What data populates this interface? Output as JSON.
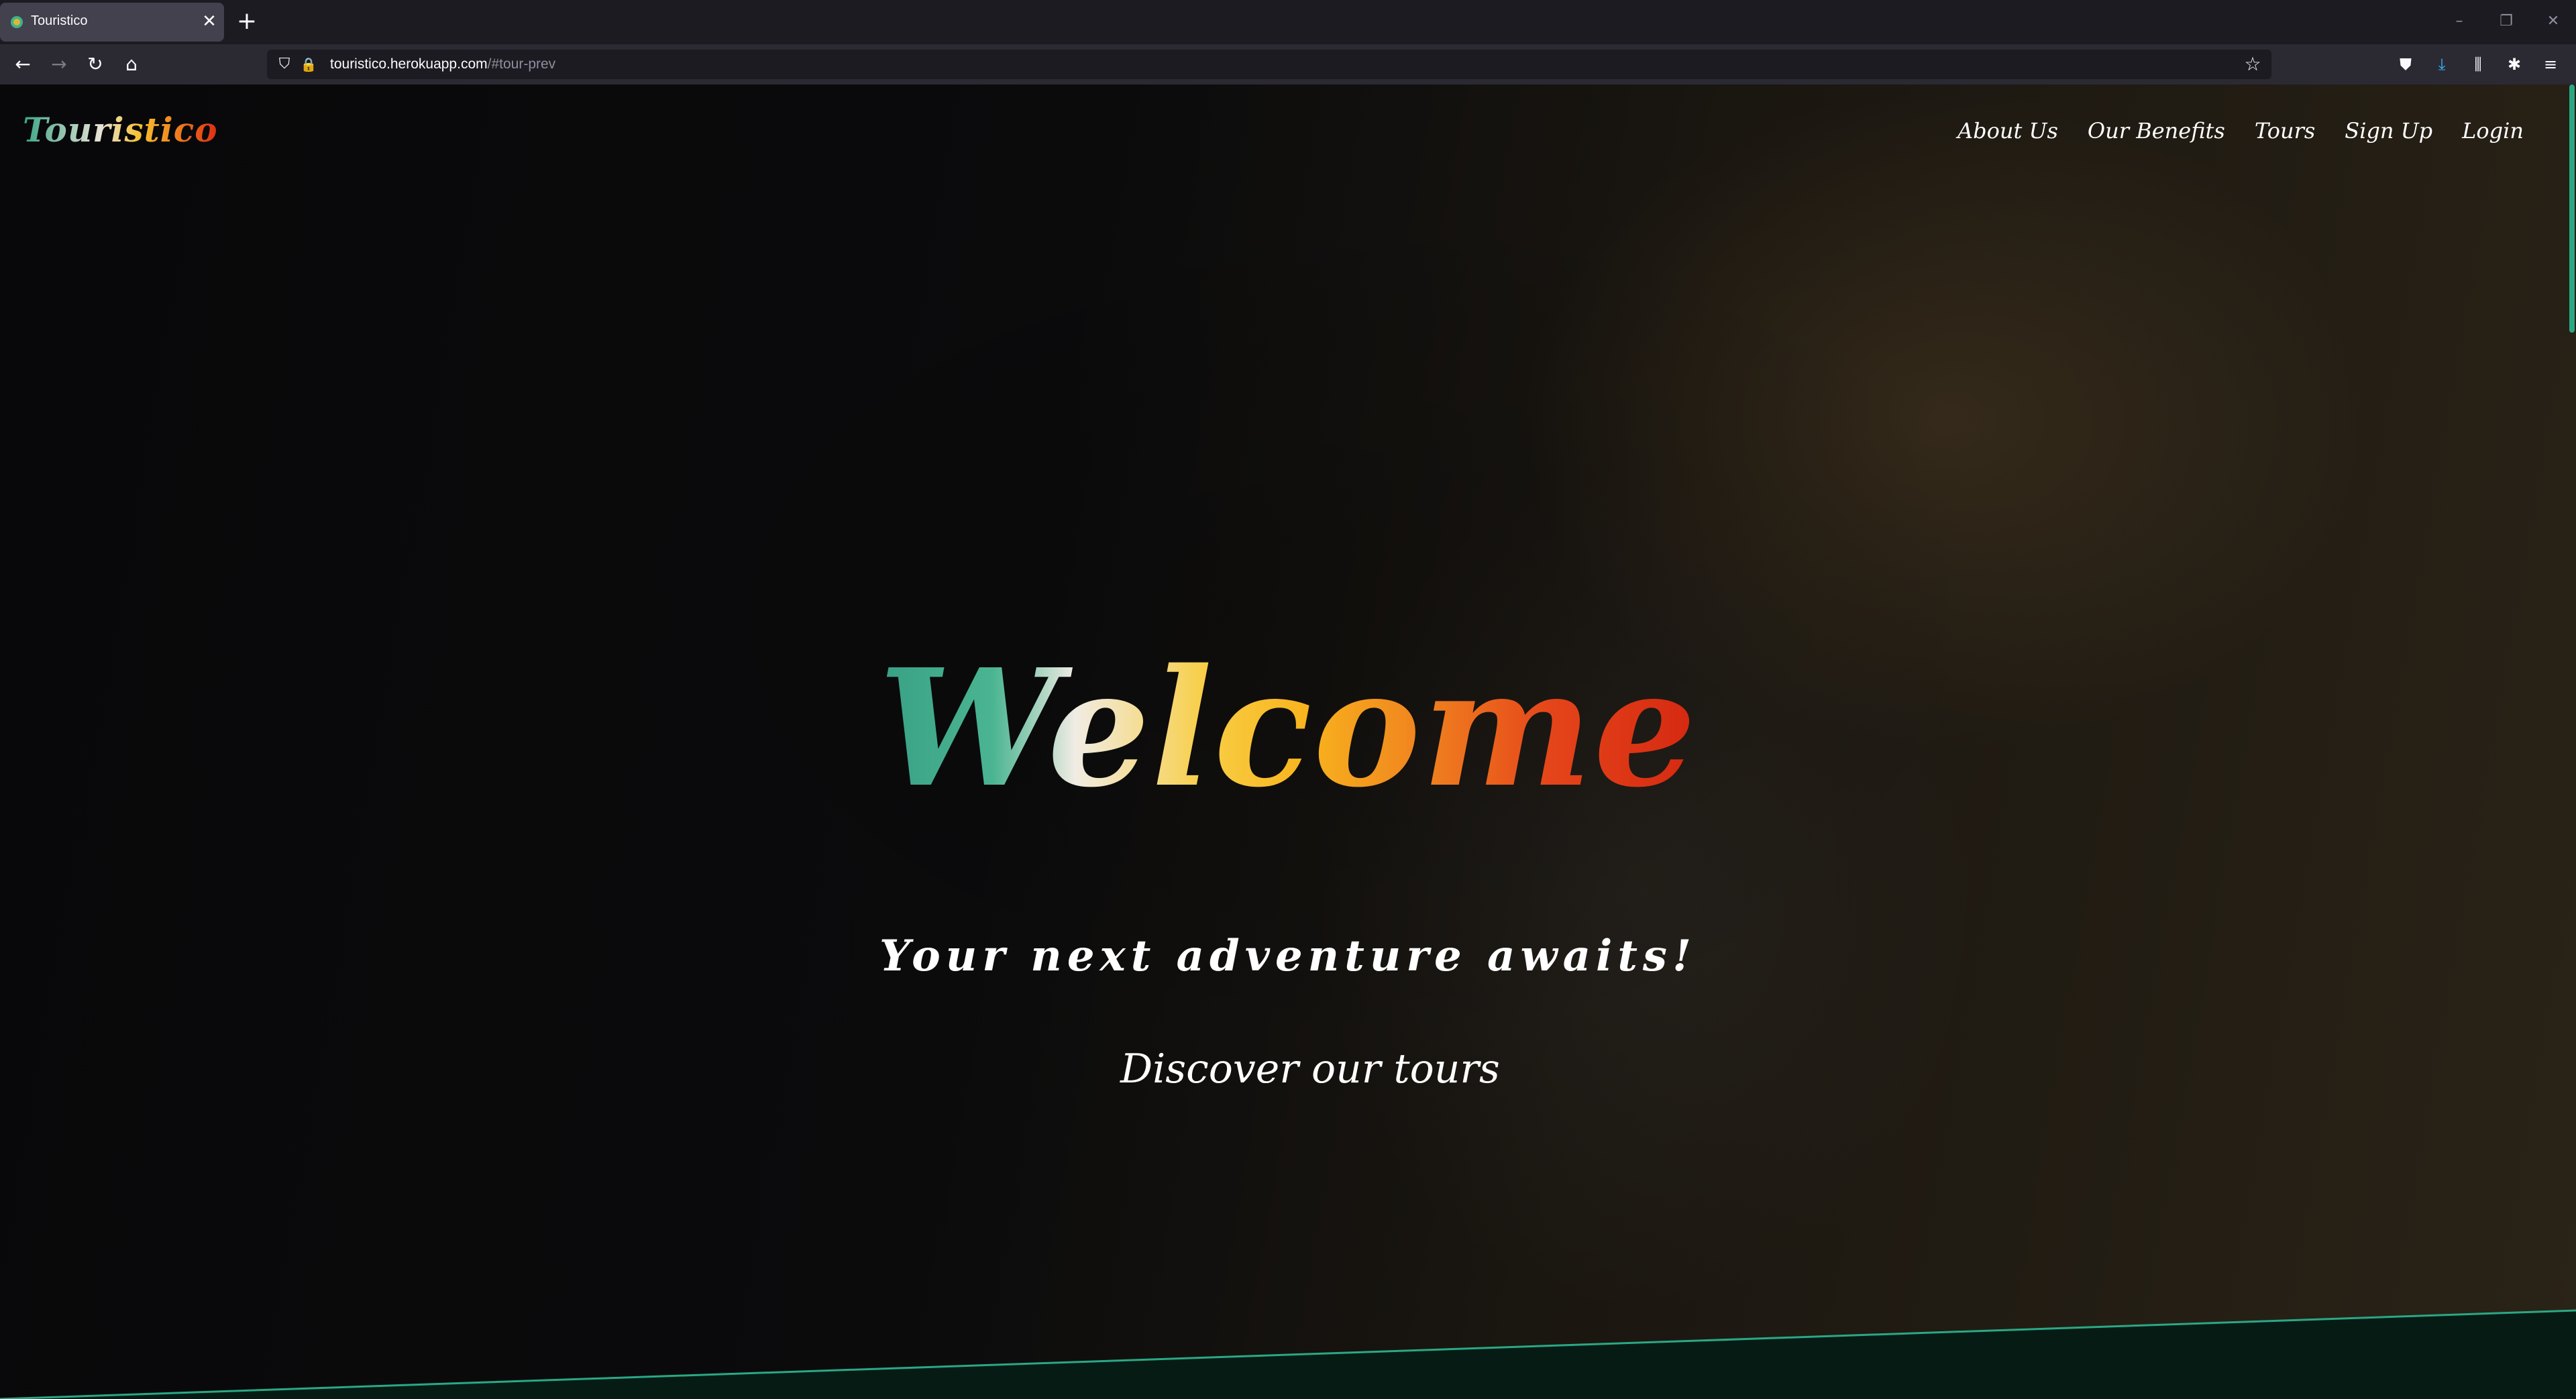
{
  "browser": {
    "tab": {
      "title": "Touristico",
      "close": "✕"
    },
    "new_tab": "+",
    "window_controls": {
      "minimize": "–",
      "restore": "❐",
      "close": "✕"
    },
    "nav": {
      "back": "←",
      "forward": "→",
      "reload": "↻",
      "home": "⌂"
    },
    "url": {
      "host": "touristico.herokuapp.com",
      "path": "/#tour-prev"
    },
    "icons": {
      "shield": "shield-icon",
      "lock": "lock-icon",
      "star": "bookmark-star-icon",
      "pocket": "pocket-icon",
      "download": "download-icon",
      "library": "library-icon",
      "extensions": "extensions-icon",
      "menu": "hamburger-menu-icon"
    },
    "glyphs": {
      "shield": "⛉",
      "lock": "🔒",
      "star": "☆",
      "pocket": "⛊",
      "download": "⤓",
      "library": "⫼",
      "extensions": "✱",
      "menu": "≡"
    }
  },
  "site": {
    "logo": "Touristico",
    "nav": [
      "About Us",
      "Our Benefits",
      "Tours",
      "Sign Up",
      "Login"
    ],
    "hero": {
      "title": "Welcome",
      "tagline": "Your next adventure awaits!",
      "cta": "Discover our tours"
    },
    "colors": {
      "accent": "#2aa884",
      "gradient": [
        "#38a084",
        "#f1ece4",
        "#f8ce45",
        "#ef7d1f",
        "#d52811"
      ]
    }
  }
}
